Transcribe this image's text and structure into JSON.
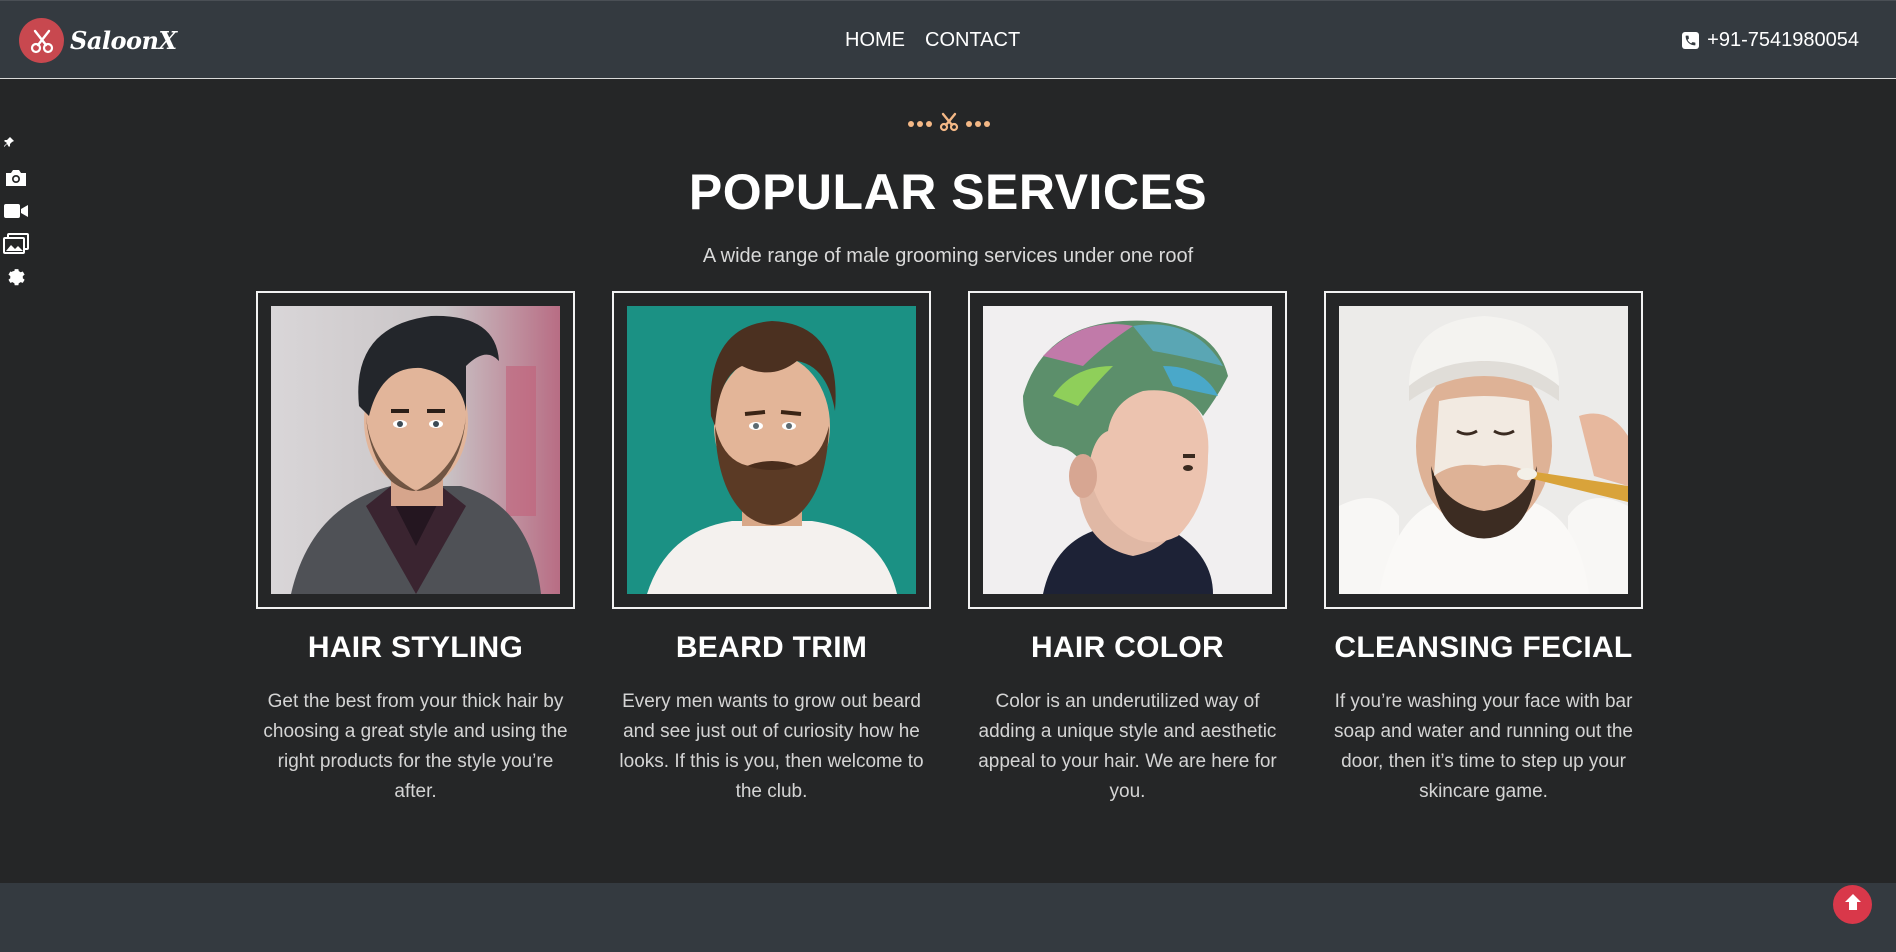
{
  "brand": {
    "name": "SaloonX",
    "logo_icon": "scissors-icon",
    "accent": "#c8484f"
  },
  "nav": {
    "links": [
      "HOME",
      "CONTACT"
    ]
  },
  "phone": {
    "icon": "phone-icon",
    "number": "+91-7541980054"
  },
  "side_tools": [
    "pin-icon",
    "camera-icon",
    "video-icon",
    "gallery-icon",
    "gear-icon"
  ],
  "section": {
    "divider_icon": "scissors-icon",
    "title": "POPULAR SERVICES",
    "subtitle": "A wide range of male grooming services under one roof"
  },
  "services": [
    {
      "title": "HAIR STYLING",
      "description": "Get the best from your thick hair by choosing a great style and using the right products for the style you’re after.",
      "image": "man-pompadour-hairstyle-photo"
    },
    {
      "title": "BEARD TRIM",
      "description": "Every men wants to grow out beard and see just out of curiosity how he looks. If this is you, then welcome to the club.",
      "image": "bearded-man-teal-background-photo"
    },
    {
      "title": "HAIR COLOR",
      "description": "Color is an underutilized way of adding a unique style and aesthetic appeal to your hair. We are here for you.",
      "image": "man-rainbow-dyed-hair-profile-photo"
    },
    {
      "title": "CLEANSING FECIAL",
      "description": "If you’re washing your face with bar soap and water and running out the door, then it’s time to step up your skincare game.",
      "image": "man-facial-mask-treatment-photo"
    }
  ],
  "back_to_top": {
    "icon": "arrow-up-icon",
    "color": "#d9384a"
  },
  "colors": {
    "navbar": "#343a40",
    "background": "#252627",
    "divider_accent": "#f4b886"
  }
}
